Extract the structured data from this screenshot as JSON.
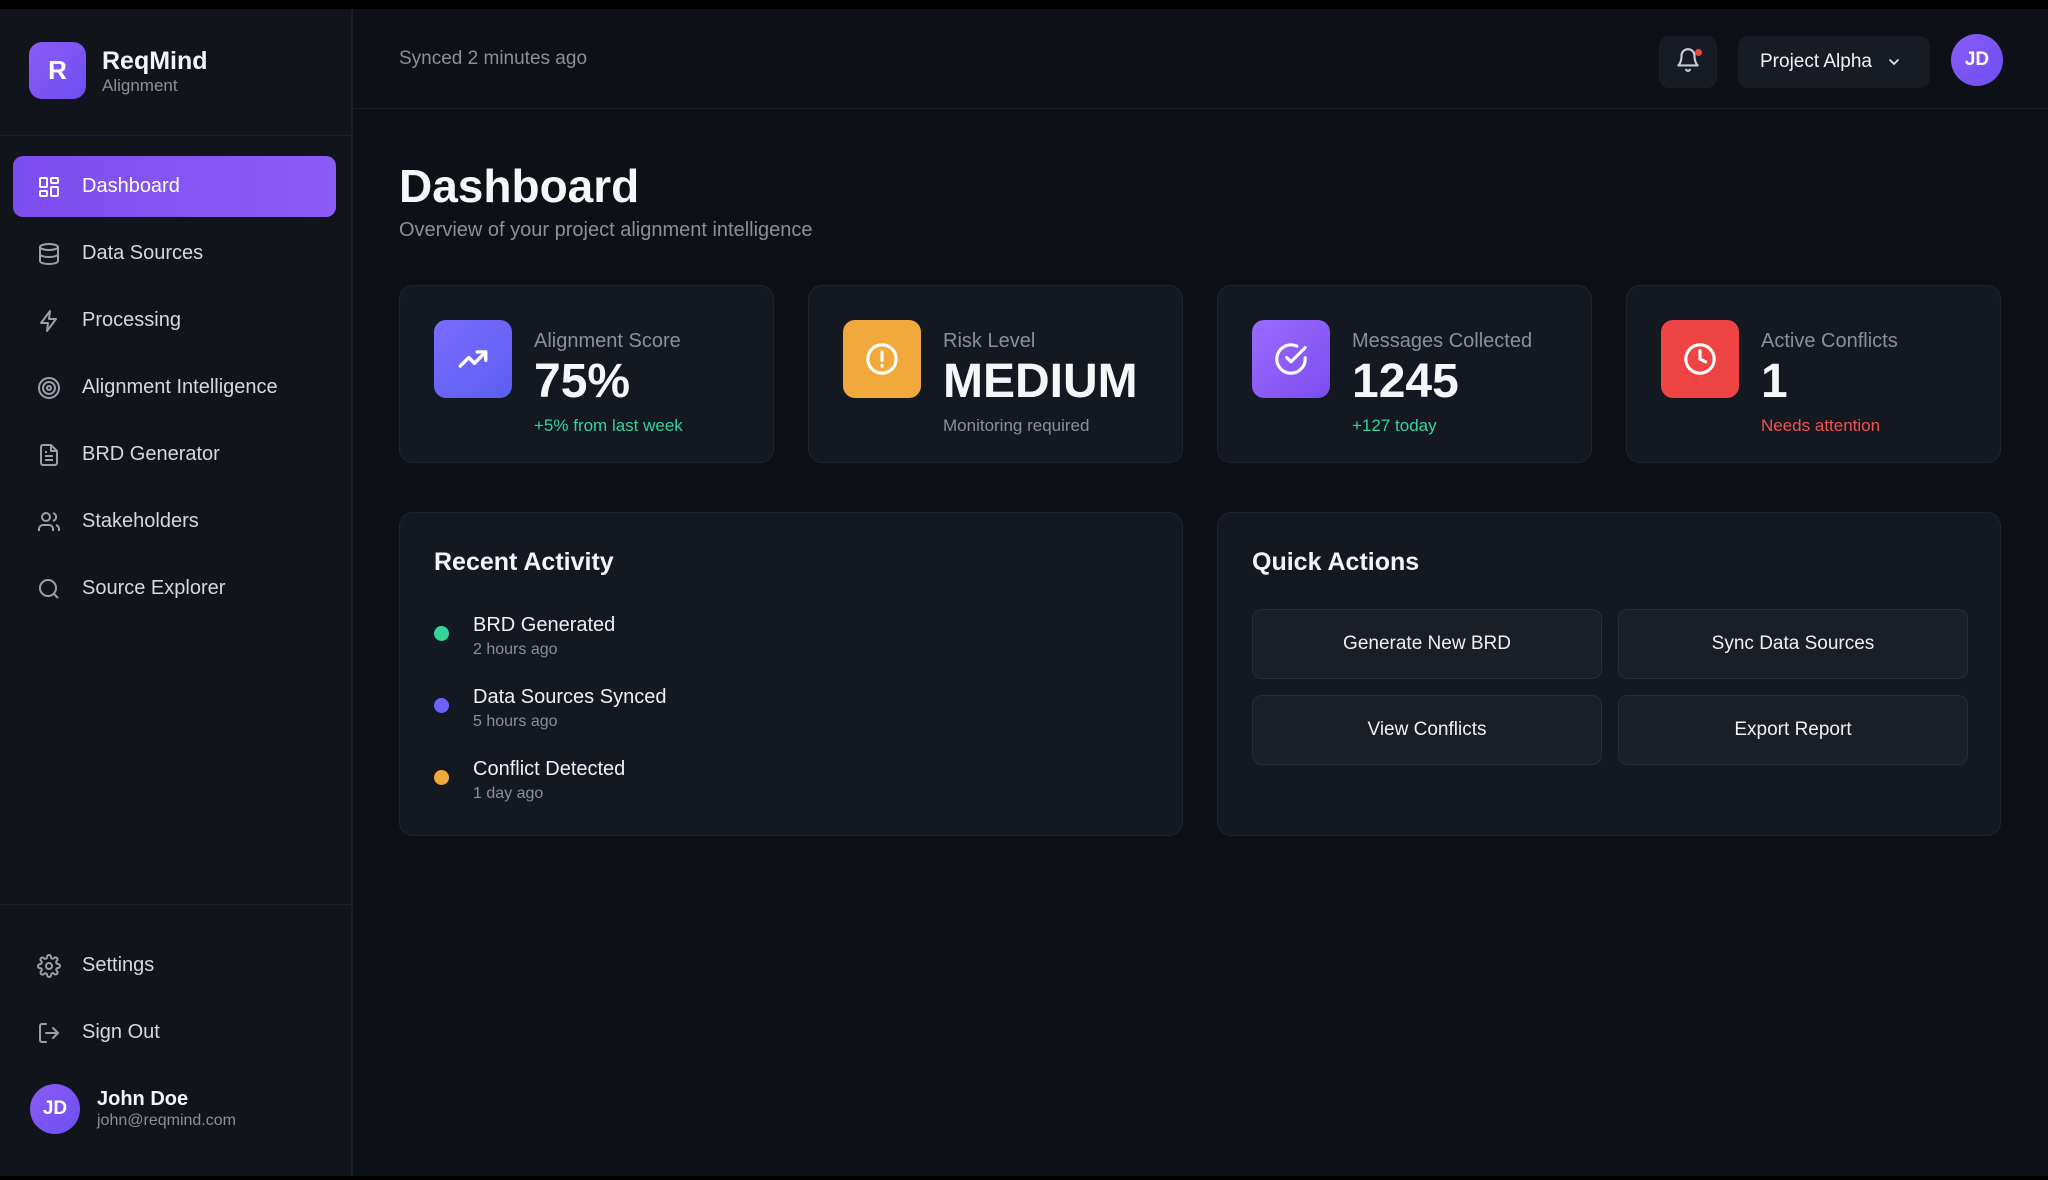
{
  "brand": {
    "logo_letter": "R",
    "name": "ReqMind",
    "subtitle": "Alignment"
  },
  "sidebar": {
    "items": [
      {
        "label": "Dashboard",
        "icon": "grid-icon",
        "active": true
      },
      {
        "label": "Data Sources",
        "icon": "database-icon"
      },
      {
        "label": "Processing",
        "icon": "lightning-icon"
      },
      {
        "label": "Alignment Intelligence",
        "icon": "target-icon"
      },
      {
        "label": "BRD Generator",
        "icon": "document-icon"
      },
      {
        "label": "Stakeholders",
        "icon": "users-icon"
      },
      {
        "label": "Source Explorer",
        "icon": "search-icon"
      }
    ],
    "bottom_items": [
      {
        "label": "Settings",
        "icon": "gear-icon"
      },
      {
        "label": "Sign Out",
        "icon": "sign-out-icon"
      }
    ],
    "user": {
      "initials": "JD",
      "name": "John Doe",
      "email": "john@reqmind.com"
    }
  },
  "header": {
    "sync_status": "Synced 2 minutes ago",
    "project": "Project Alpha",
    "avatar_initials": "JD"
  },
  "page": {
    "title": "Dashboard",
    "subtitle": "Overview of your project alignment intelligence"
  },
  "stats": [
    {
      "label": "Alignment Score",
      "value": "75%",
      "note": "+5% from last week",
      "icon": "trending-up-icon",
      "color": "#6c63ff",
      "note_color": "#34d399"
    },
    {
      "label": "Risk Level",
      "value": "MEDIUM",
      "note": "Monitoring required",
      "icon": "alert-circle-icon",
      "color": "#f2a93b",
      "note_color": "#8a8f99"
    },
    {
      "label": "Messages Collected",
      "value": "1245",
      "note": "+127 today",
      "icon": "check-circle-icon",
      "color": "#8b5cf6",
      "note_color": "#34d399"
    },
    {
      "label": "Active Conflicts",
      "value": "1",
      "note": "Needs attention",
      "icon": "clock-icon",
      "color": "#ef4444",
      "note_color": "#f05252"
    }
  ],
  "recent_activity": {
    "title": "Recent Activity",
    "items": [
      {
        "title": "BRD Generated",
        "time": "2 hours ago",
        "color": "#34d399"
      },
      {
        "title": "Data Sources Synced",
        "time": "5 hours ago",
        "color": "#6c63ff"
      },
      {
        "title": "Conflict Detected",
        "time": "1 day ago",
        "color": "#f2a93b"
      }
    ]
  },
  "quick_actions": {
    "title": "Quick Actions",
    "buttons": [
      "Generate New BRD",
      "Sync Data Sources",
      "View Conflicts",
      "Export Report"
    ]
  }
}
